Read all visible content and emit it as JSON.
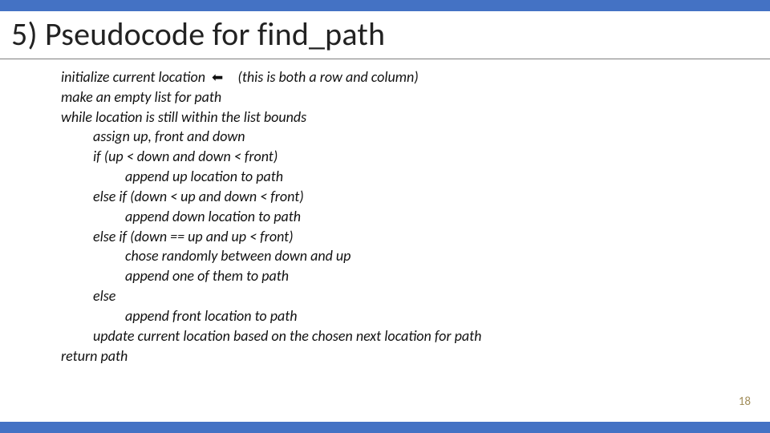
{
  "slide": {
    "title": "5) Pseudocode for find_path",
    "code": {
      "l1_a": "initialize current location",
      "l1_arrow": "⬅",
      "l1_b": "(this is both a row and column)",
      "l2": "make an empty list for path",
      "l3": "while location is still within the list bounds",
      "l4": "assign up, front and down",
      "l5": "if (up < down and down < front)",
      "l6": "append up location to path",
      "l7": "else if (down < up and down < front)",
      "l8": "append down location to path",
      "l9": "else if (down == up and up < front)",
      "l10": "chose randomly between down and up",
      "l11": "append one of them to path",
      "l12": "else",
      "l13": "append front location to path",
      "l14": "update current location based on the chosen next location for path",
      "l15": "return path"
    },
    "page_number": "18"
  }
}
